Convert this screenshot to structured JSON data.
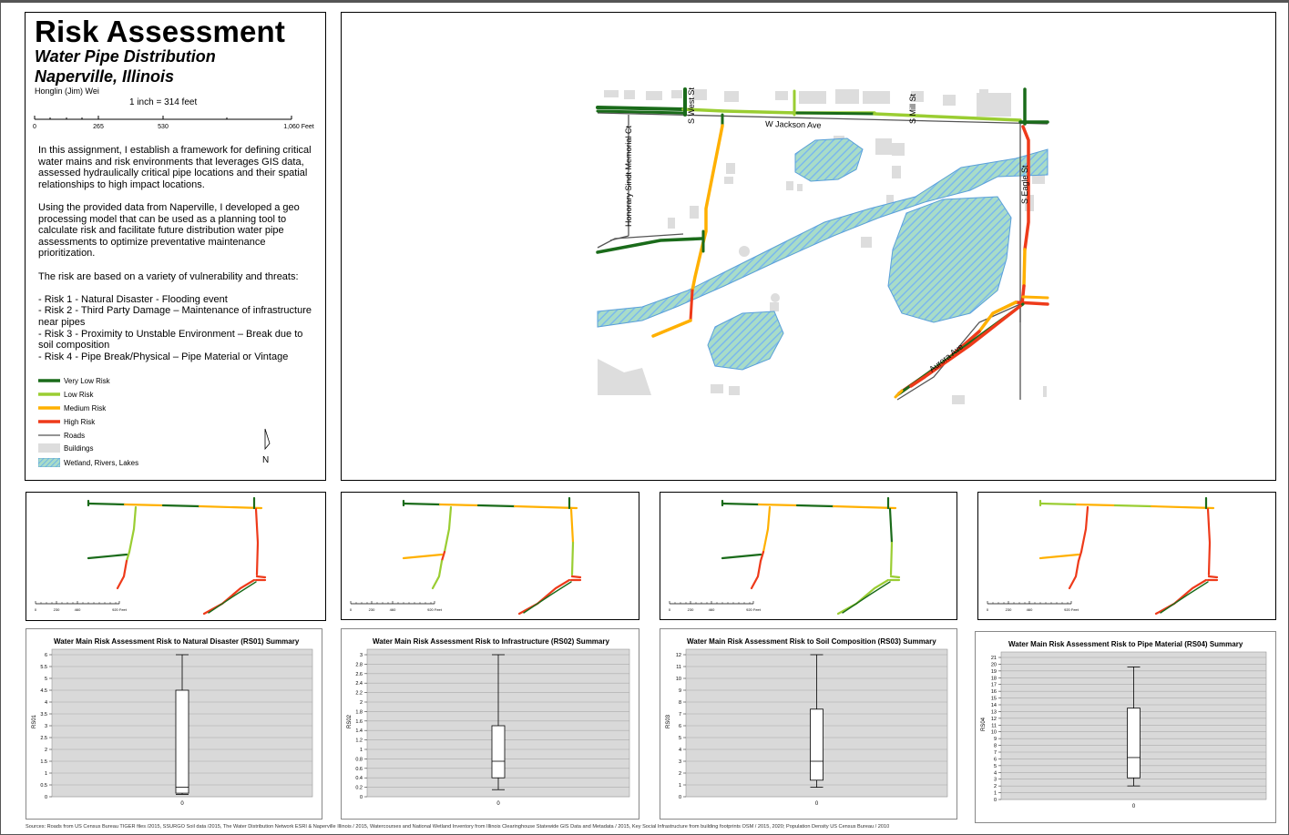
{
  "title": "Risk Assessment",
  "subtitle1": "Water Pipe Distribution",
  "subtitle2": "Naperville, Illinois",
  "author": "Honglin (Jim) Wei",
  "scale": {
    "ratio": "1 inch = 314 feet",
    "ticks": [
      "0",
      "265",
      "530",
      "1,060 Feet"
    ]
  },
  "description": [
    "In this assignment, I establish a framework for defining critical water mains and risk environments that leverages GIS data, assessed hydraulically critical pipe locations and their spatial relationships to high impact locations.",
    "Using the provided data from Naperville, I developed a geo processing model that can be used as a planning tool to calculate risk and facilitate future distribution water pipe assessments to optimize preventative maintenance prioritization.",
    "The risk are based on a variety of vulnerability and threats:",
    "- Risk 1 - Natural Disaster - Flooding event",
    "- Risk 2 - Third Party Damage – Maintenance of infrastructure near pipes",
    "- Risk 3 - Proximity to Unstable Environment – Break due to soil composition",
    "- Risk 4 - Pipe Break/Physical – Pipe Material or Vintage"
  ],
  "legend": [
    {
      "label": "Very Low Risk",
      "symbol": "line",
      "color": "#1a6b1a"
    },
    {
      "label": "Low Risk",
      "symbol": "line",
      "color": "#9acd32"
    },
    {
      "label": "Medium Risk",
      "symbol": "line",
      "color": "#ffb000"
    },
    {
      "label": "High Risk",
      "symbol": "line",
      "color": "#ee3a1a"
    },
    {
      "label": "Roads",
      "symbol": "thin-line",
      "color": "#555555"
    },
    {
      "label": "Buildings",
      "symbol": "box",
      "color": "#dddddd"
    },
    {
      "label": "Wetland, Rivers, Lakes",
      "symbol": "hatch",
      "color": "#7ec8e3"
    }
  ],
  "north_arrow": "N",
  "map_labels": {
    "jackson": "W Jackson Ave",
    "west": "S West St",
    "mill": "S Mill St",
    "eagle": "S Eagle St",
    "sindt": "Honorary Sindt Memorial Ct",
    "aurora": "Aurora Ave"
  },
  "mini_scale_ticks": [
    "0",
    "230",
    "460",
    "920 Feet"
  ],
  "colors": {
    "very_low": "#1a6b1a",
    "low": "#9acd32",
    "medium": "#ffb000",
    "high": "#ee3a1a",
    "road": "#555555",
    "building": "#dddddd",
    "water": "#7ec8e3"
  },
  "chart_data": [
    {
      "type": "box",
      "title": "Water Main Risk Assessment Risk to Natural Disaster (RS01) Summary",
      "ylabel": "RS01",
      "categories": [
        "0"
      ],
      "ylim": [
        0,
        6
      ],
      "yticks": [
        "0",
        "0.5",
        "1",
        "1.5",
        "2",
        "2.5",
        "3",
        "3.5",
        "4",
        "4.5",
        "5",
        "5.5",
        "6"
      ],
      "min": 0.1,
      "q1": 0.15,
      "median": 0.4,
      "q3": 4.5,
      "max": 6
    },
    {
      "type": "box",
      "title": "Water Main Risk Assessment Risk to Infrastructure (RS02) Summary",
      "ylabel": "RS02",
      "categories": [
        "0"
      ],
      "ylim": [
        0,
        3
      ],
      "yticks": [
        "0",
        "0.2",
        "0.4",
        "0.6",
        "0.8",
        "1",
        "1.2",
        "1.4",
        "1.6",
        "1.8",
        "2",
        "2.2",
        "2.4",
        "2.6",
        "2.8",
        "3"
      ],
      "min": 0.15,
      "q1": 0.4,
      "median": 0.75,
      "q3": 1.5,
      "max": 3
    },
    {
      "type": "box",
      "title": "Water Main Risk Assessment Risk to Soil Composition (RS03) Summary",
      "ylabel": "RS03",
      "categories": [
        "0"
      ],
      "ylim": [
        0,
        12
      ],
      "yticks": [
        "0",
        "1",
        "2",
        "3",
        "4",
        "5",
        "6",
        "7",
        "8",
        "9",
        "10",
        "11",
        "12"
      ],
      "min": 0.8,
      "q1": 1.4,
      "median": 3,
      "q3": 7.4,
      "max": 12
    },
    {
      "type": "box",
      "title": "Water Main Risk Assessment Risk to Pipe Material (RS04) Summary",
      "ylabel": "RS04",
      "categories": [
        "0"
      ],
      "ylim": [
        0,
        21
      ],
      "yticks": [
        "0",
        "1",
        "2",
        "3",
        "4",
        "5",
        "6",
        "7",
        "8",
        "9",
        "10",
        "11",
        "12",
        "13",
        "14",
        "15",
        "16",
        "17",
        "18",
        "19",
        "20",
        "21"
      ],
      "min": 2,
      "q1": 3.2,
      "median": 6.2,
      "q3": 13.5,
      "max": 19.6
    }
  ],
  "sources": "Sources: Roads from US Census Bureau TIGER files /2015, SSURGO Soil data /2015, The Water Distribution Network ESRI & Naperville Illinois / 2015, Watercourses and National Wetland Inventory from Illinois Clearinghouse Statewide GIS Data and Metadata / 2015, Key Social Infrastructure from building footprints OSM / 2015, 2020; Population Density US Census Bureau / 2010"
}
